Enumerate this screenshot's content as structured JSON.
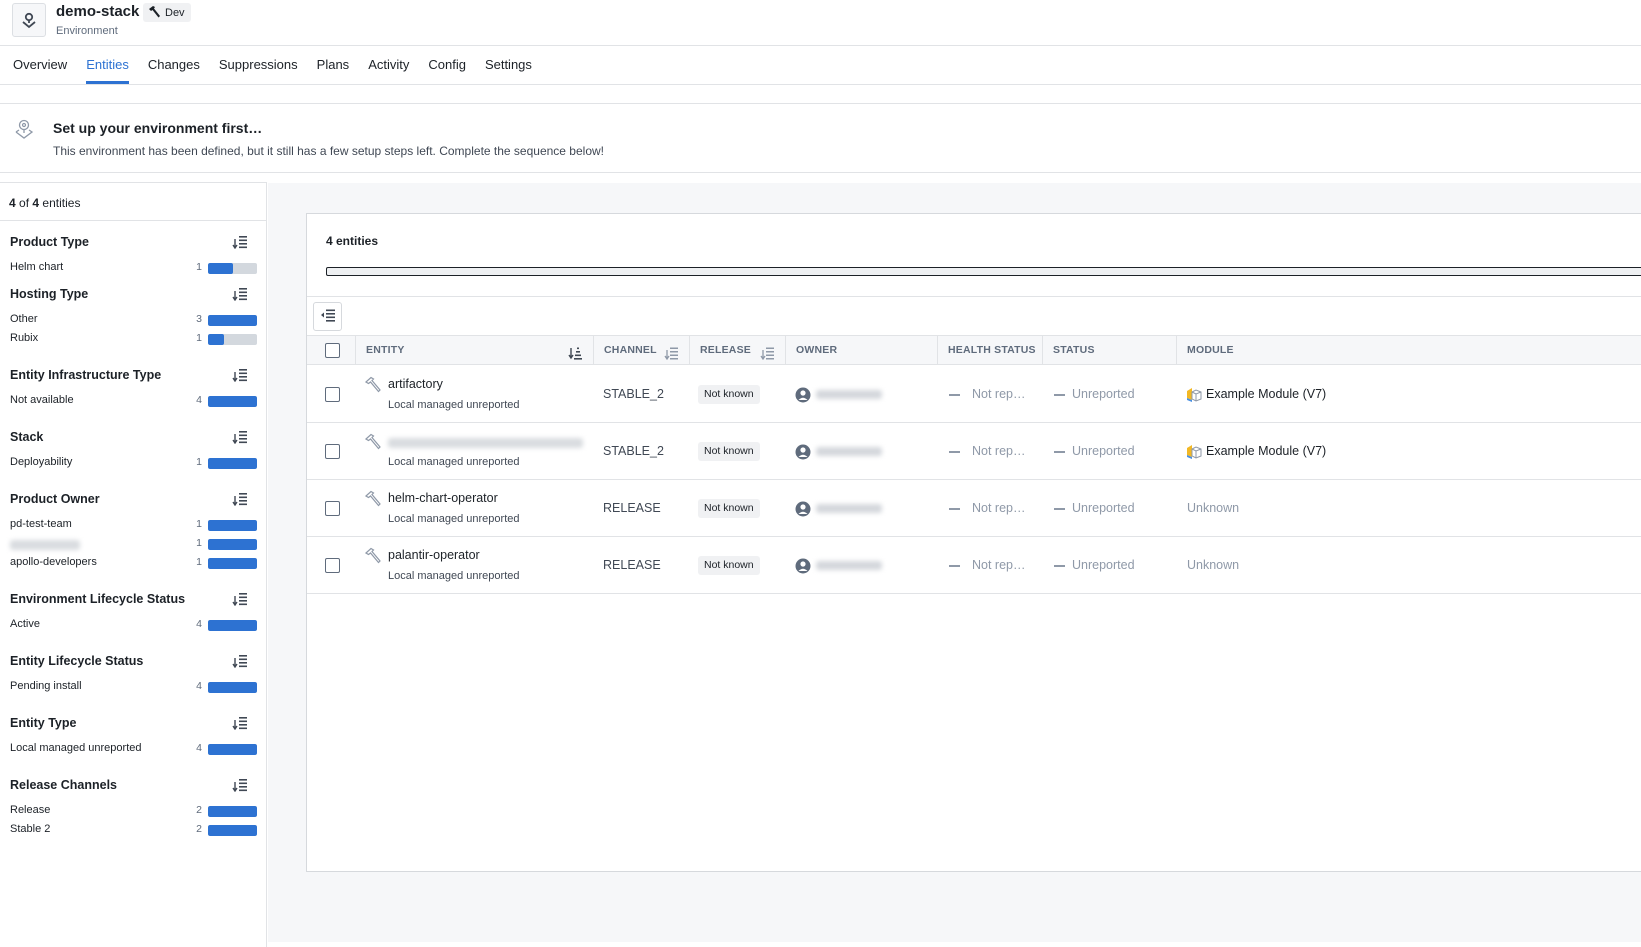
{
  "header": {
    "title": "demo-stack",
    "subtitle": "Environment",
    "tag": "Dev"
  },
  "tabs": [
    {
      "label": "Overview",
      "active": false
    },
    {
      "label": "Entities",
      "active": true
    },
    {
      "label": "Changes",
      "active": false
    },
    {
      "label": "Suppressions",
      "active": false
    },
    {
      "label": "Plans",
      "active": false
    },
    {
      "label": "Activity",
      "active": false
    },
    {
      "label": "Config",
      "active": false
    },
    {
      "label": "Settings",
      "active": false
    }
  ],
  "banner": {
    "title": "Set up your environment first…",
    "text": "This environment has been defined, but it still has a few setup steps left. Complete the sequence below!"
  },
  "sidebar": {
    "count": {
      "shown": "4",
      "of_label": "of",
      "total": "4",
      "suffix": "entities"
    },
    "facets": [
      {
        "title": "Product Type",
        "items": [
          {
            "label": "Helm chart",
            "count": "1",
            "fraction": 0.5
          }
        ]
      },
      {
        "title": "Hosting Type",
        "items": [
          {
            "label": "Other",
            "count": "3",
            "fraction": 1.0
          },
          {
            "label": "Rubix",
            "count": "1",
            "fraction": 0.33
          }
        ]
      },
      {
        "title": "Entity Infrastructure Type",
        "items": [
          {
            "label": "Not available",
            "count": "4",
            "fraction": 1.0
          }
        ]
      },
      {
        "title": "Stack",
        "items": [
          {
            "label": "Deployability",
            "count": "1",
            "fraction": 1.0
          }
        ]
      },
      {
        "title": "Product Owner",
        "items": [
          {
            "label": "pd-test-team",
            "count": "1",
            "fraction": 1.0
          },
          {
            "label": "",
            "count": "1",
            "fraction": 1.0,
            "blurred": true
          },
          {
            "label": "apollo-developers",
            "count": "1",
            "fraction": 1.0
          }
        ]
      },
      {
        "title": "Environment Lifecycle Status",
        "items": [
          {
            "label": "Active",
            "count": "4",
            "fraction": 1.0
          }
        ]
      },
      {
        "title": "Entity Lifecycle Status",
        "items": [
          {
            "label": "Pending install",
            "count": "4",
            "fraction": 1.0
          }
        ]
      },
      {
        "title": "Entity Type",
        "items": [
          {
            "label": "Local managed unreported",
            "count": "4",
            "fraction": 1.0
          }
        ]
      },
      {
        "title": "Release Channels",
        "items": [
          {
            "label": "Release",
            "count": "2",
            "fraction": 1.0
          },
          {
            "label": "Stable 2",
            "count": "2",
            "fraction": 1.0
          }
        ]
      }
    ]
  },
  "main": {
    "card_title": "4 entities",
    "columns": [
      "ENTITY",
      "CHANNEL",
      "RELEASE",
      "OWNER",
      "HEALTH STATUS",
      "STATUS",
      "MODULE"
    ],
    "rows": [
      {
        "name": "artifactory",
        "type": "Local managed unreported",
        "channel": "STABLE_2",
        "release": "Not known",
        "health": "Not rep…",
        "status": "Unreported",
        "module": "Example Module (V7)",
        "module_known": true
      },
      {
        "name": "",
        "name_blurred": true,
        "type": "Local managed unreported",
        "channel": "STABLE_2",
        "release": "Not known",
        "health": "Not rep…",
        "status": "Unreported",
        "module": "Example Module (V7)",
        "module_known": true
      },
      {
        "name": "helm-chart-operator",
        "type": "Local managed unreported",
        "channel": "RELEASE",
        "release": "Not known",
        "health": "Not rep…",
        "status": "Unreported",
        "module": "Unknown",
        "module_known": false
      },
      {
        "name": "palantir-operator",
        "type": "Local managed unreported",
        "channel": "RELEASE",
        "release": "Not known",
        "health": "Not rep…",
        "status": "Unreported",
        "module": "Unknown",
        "module_known": false
      }
    ]
  },
  "colors": {
    "accent": "#2d72d2",
    "bar_track": "#d3d8de",
    "muted_text": "#8f99a8"
  }
}
